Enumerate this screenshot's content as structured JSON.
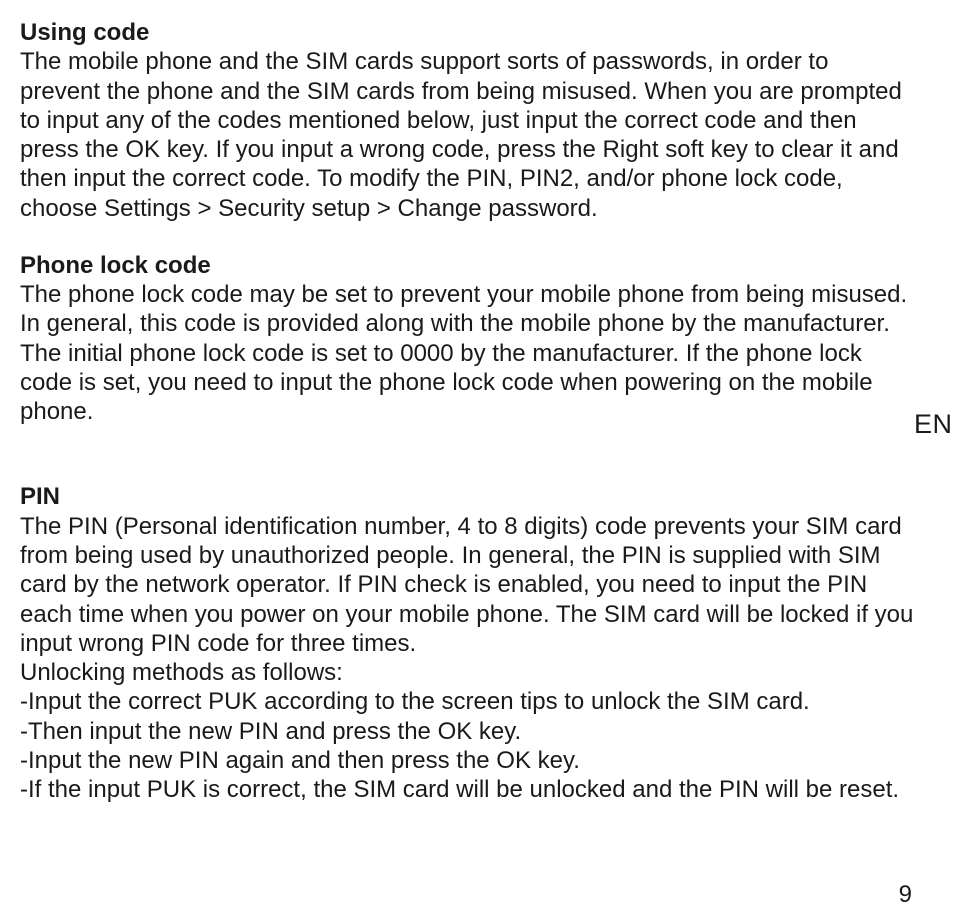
{
  "sections": {
    "s1": {
      "heading": "Using code",
      "body": "The mobile phone and the SIM cards support sorts of passwords, in order to prevent the phone and the SIM cards from being misused. When you are prompted to input any of the codes mentioned below, just input the correct code and then press the OK key. If you input a wrong code, press the Right soft key to clear it and then input the correct code. To modify the PIN, PIN2, and/or phone lock code, choose Settings > Security setup > Change password."
    },
    "s2": {
      "heading": "Phone lock code",
      "body": "The phone lock code may be set to prevent your mobile phone from being misused. In general, this code is provided along with the mobile phone by the manufacturer. The initial phone lock code is set to 0000 by the manufacturer. If the phone lock code is set, you need to input the phone lock code when powering on the mobile phone."
    },
    "s3": {
      "heading": "PIN",
      "body": "The PIN (Personal identification number, 4 to 8 digits) code prevents your SIM card from being used by unauthorized people. In general, the PIN is supplied with SIM card by the network operator. If PIN check is enabled, you need to input the PIN each time when you power on your mobile phone. The SIM card will be locked if you input wrong PIN code for three times.",
      "line1": "Unlocking methods as follows:",
      "line2": "-Input the correct PUK according to the screen tips to unlock the SIM card.",
      "line3": "-Then input the new PIN and press the OK key.",
      "line4": "-Input the new PIN again and then press the OK key.",
      "line5": "-If the input PUK is correct, the SIM card will be unlocked and the PIN will be reset."
    }
  },
  "lang_tab": "EN",
  "page_number": "9"
}
